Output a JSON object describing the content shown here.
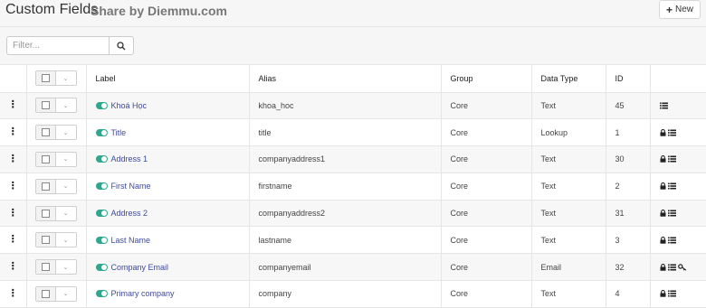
{
  "header": {
    "title": "Custom Fields",
    "watermark": "Share by Diemmu.com",
    "new_button_label": "New"
  },
  "filter": {
    "placeholder": "Filter...",
    "value": ""
  },
  "table": {
    "columns": [
      "Label",
      "Alias",
      "Group",
      "Data Type",
      "ID"
    ],
    "rows": [
      {
        "label": "Khoá Học",
        "alias": "khoa_hoc",
        "group": "Core",
        "type": "Text",
        "id": "45",
        "icons": [
          "list-icon"
        ]
      },
      {
        "label": "Title",
        "alias": "title",
        "group": "Core",
        "type": "Lookup",
        "id": "1",
        "icons": [
          "lock-icon",
          "list-icon"
        ]
      },
      {
        "label": "Address 1",
        "alias": "companyaddress1",
        "group": "Core",
        "type": "Text",
        "id": "30",
        "icons": [
          "lock-icon",
          "list-icon"
        ]
      },
      {
        "label": "First Name",
        "alias": "firstname",
        "group": "Core",
        "type": "Text",
        "id": "2",
        "icons": [
          "lock-icon",
          "list-icon"
        ]
      },
      {
        "label": "Address 2",
        "alias": "companyaddress2",
        "group": "Core",
        "type": "Text",
        "id": "31",
        "icons": [
          "lock-icon",
          "list-icon"
        ]
      },
      {
        "label": "Last Name",
        "alias": "lastname",
        "group": "Core",
        "type": "Text",
        "id": "3",
        "icons": [
          "lock-icon",
          "list-icon"
        ]
      },
      {
        "label": "Company Email",
        "alias": "companyemail",
        "group": "Core",
        "type": "Email",
        "id": "32",
        "icons": [
          "lock-icon",
          "list-icon",
          "key-icon"
        ]
      },
      {
        "label": "Primary company",
        "alias": "company",
        "group": "Core",
        "type": "Text",
        "id": "4",
        "icons": [
          "lock-icon",
          "list-icon"
        ]
      }
    ]
  },
  "colors": {
    "toggle_on": "#2fa78e",
    "link": "#3f4a9c"
  }
}
